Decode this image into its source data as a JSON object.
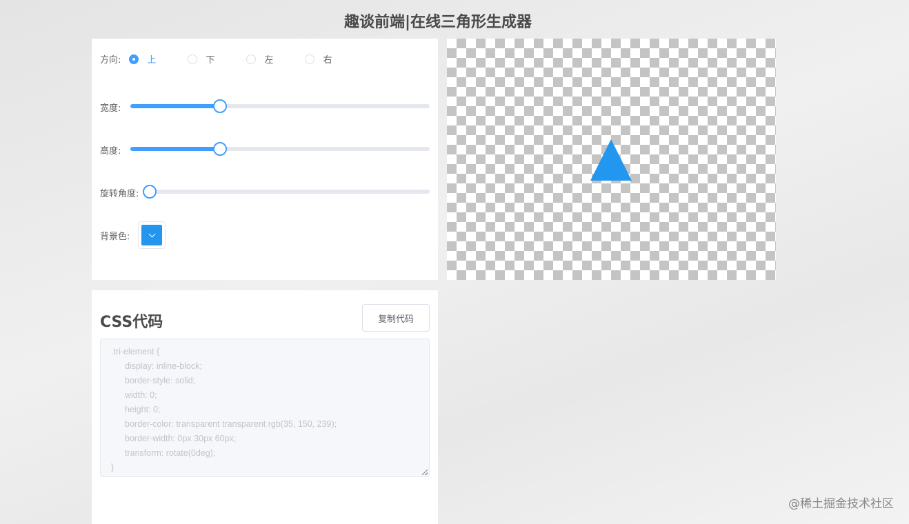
{
  "title": "趣谈前端|在线三角形生成器",
  "controls": {
    "direction": {
      "label": "方向:",
      "options": [
        "上",
        "下",
        "左",
        "右"
      ],
      "selected": "上"
    },
    "width": {
      "label": "宽度:",
      "value_fraction": 0.3
    },
    "height": {
      "label": "高度:",
      "value_fraction": 0.3
    },
    "rotation": {
      "label": "旋转角度:",
      "value_fraction": 0.0
    },
    "bgcolor": {
      "label": "背景色:",
      "color": "#2396ef"
    }
  },
  "code": {
    "title": "CSS代码",
    "copy_label": "复制代码",
    "lines": [
      ".tri-element {",
      "display: inline-block;",
      "border-style: solid;",
      "width: 0;",
      "height: 0;",
      "border-color: transparent transparent rgb(35, 150, 239);",
      "border-width: 0px 30px 60px;",
      "transform: rotate(0deg);",
      "}"
    ]
  },
  "watermark": "@稀土掘金技术社区",
  "colors": {
    "accent": "#409eff",
    "triangle": "#2396ef"
  }
}
